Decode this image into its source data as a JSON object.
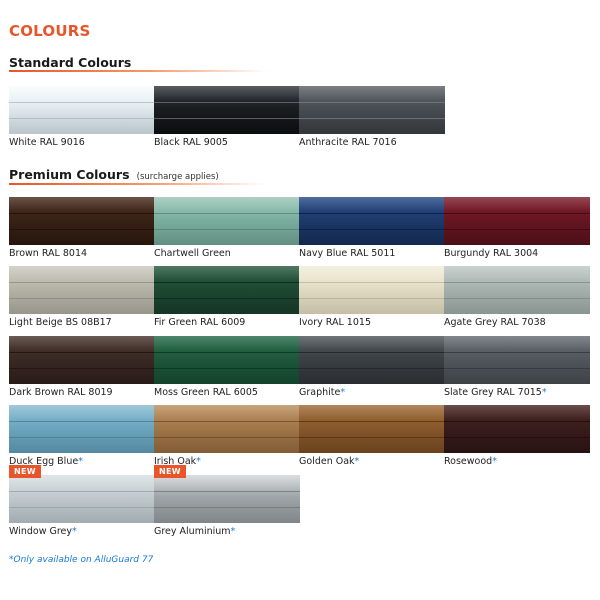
{
  "title": "COLOURS",
  "standard": {
    "heading": "Standard Colours",
    "swatches": [
      {
        "label": "White RAL 9016",
        "star": "",
        "base": "#e4edf2",
        "light": "#f7fbfd",
        "dark": "#c9d6dd",
        "groove": "#b9c6ce",
        "new": ""
      },
      {
        "label": "Black RAL 9005",
        "star": "",
        "base": "#1c1f22",
        "light": "#343a40",
        "dark": "#0c0e10",
        "groove": "#5a6168",
        "new": ""
      },
      {
        "label": "Anthracite RAL 7016",
        "star": "",
        "base": "#4a4f55",
        "light": "#5e646a",
        "dark": "#373b40",
        "groove": "#6f757b",
        "new": ""
      }
    ]
  },
  "premium": {
    "heading": "Premium Colours",
    "note": "(surcharge applies)",
    "swatches": [
      {
        "label": "Brown RAL 8014",
        "star": "",
        "base": "#3a2216",
        "light": "#4a2e1f",
        "dark": "#2a170e",
        "groove": "#22130b",
        "new": ""
      },
      {
        "label": "Chartwell Green",
        "star": "",
        "base": "#7fb2a2",
        "light": "#9ac6b7",
        "dark": "#6a9c8d",
        "groove": "#5e8f80",
        "new": ""
      },
      {
        "label": "Navy Blue RAL 5011",
        "star": "",
        "base": "#1d3b6e",
        "light": "#2a4c86",
        "dark": "#142b54",
        "groove": "#0f2244",
        "new": ""
      },
      {
        "label": "Burgundy RAL 3004",
        "star": "",
        "base": "#6a1622",
        "light": "#7e1f2d",
        "dark": "#521019",
        "groove": "#400b12",
        "new": ""
      },
      {
        "label": "Light Beige BS 08B17",
        "star": "",
        "base": "#b9b6aa",
        "light": "#cbc8bd",
        "dark": "#a5a296",
        "groove": "#98958a",
        "new": ""
      },
      {
        "label": "Fir Green RAL 6009",
        "star": "",
        "base": "#1f4a34",
        "light": "#2a5c42",
        "dark": "#163a28",
        "groove": "#0f2e1f",
        "new": ""
      },
      {
        "label": "Ivory RAL 1015",
        "star": "",
        "base": "#e6e0c8",
        "light": "#f2edd9",
        "dark": "#d4ceb4",
        "groove": "#c6bfa4",
        "new": ""
      },
      {
        "label": "Agate Grey RAL 7038",
        "star": "",
        "base": "#aab5b2",
        "light": "#bec8c5",
        "dark": "#96a19e",
        "groove": "#8a9592",
        "new": ""
      },
      {
        "label": "Dark Brown RAL 8019",
        "star": "",
        "base": "#3b2a24",
        "light": "#4a3730",
        "dark": "#2b1e19",
        "groove": "#221712",
        "new": ""
      },
      {
        "label": "Moss Green RAL 6005",
        "star": "",
        "base": "#1e5a3c",
        "light": "#286c4a",
        "dark": "#15482f",
        "groove": "#0f3a25",
        "new": ""
      },
      {
        "label": "Graphite",
        "star": "*",
        "base": "#3d4246",
        "light": "#50565b",
        "dark": "#2d3135",
        "groove": "#262a2d",
        "new": ""
      },
      {
        "label": "Slate Grey RAL 7015",
        "star": "*",
        "base": "#53595f",
        "light": "#676d73",
        "dark": "#42474c",
        "groove": "#393e42",
        "new": ""
      },
      {
        "label": "Duck Egg Blue",
        "star": "*",
        "base": "#6fa9c2",
        "light": "#8bbcd2",
        "dark": "#5b95ae",
        "groove": "#4f88a1",
        "new": ""
      },
      {
        "label": "Irish Oak",
        "star": "*",
        "base": "#a57a4c",
        "light": "#bb9062",
        "dark": "#8c643a",
        "groove": "#7a552f",
        "new": ""
      },
      {
        "label": "Golden Oak",
        "star": "*",
        "base": "#8a5a2c",
        "light": "#a06c38",
        "dark": "#724820",
        "groove": "#5f3b19",
        "new": ""
      },
      {
        "label": "Rosewood",
        "star": "*",
        "base": "#3a1d1c",
        "light": "#4a2826",
        "dark": "#2b1413",
        "groove": "#220f0e",
        "new": ""
      },
      {
        "label": "Window Grey",
        "star": "*",
        "base": "#c4cdd1",
        "light": "#d8dfe2",
        "dark": "#b0babf",
        "groove": "#a3adb2",
        "new": "NEW"
      },
      {
        "label": "Grey Aluminium",
        "star": "*",
        "base": "#a2a8ab",
        "light": "#d2d6d8",
        "dark": "#8b9194",
        "groove": "#7d8386",
        "new": "NEW"
      }
    ]
  },
  "footnote": "*Only available on AlluGuard 77"
}
